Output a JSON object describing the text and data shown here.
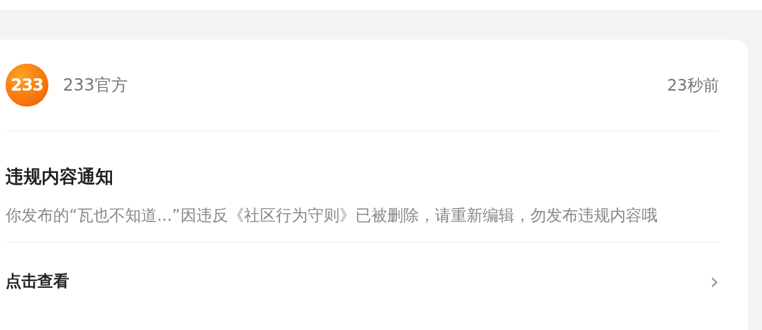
{
  "sender": {
    "logo": "233",
    "name": "233官方",
    "time": "23秒前"
  },
  "notice": {
    "title": "违规内容通知",
    "body": "你发布的“瓦也不知道...”因违反《社区行为守则》已被删除，请重新编辑，勿发布违规内容哦"
  },
  "action": {
    "label": "点击查看",
    "chevron": "›"
  }
}
